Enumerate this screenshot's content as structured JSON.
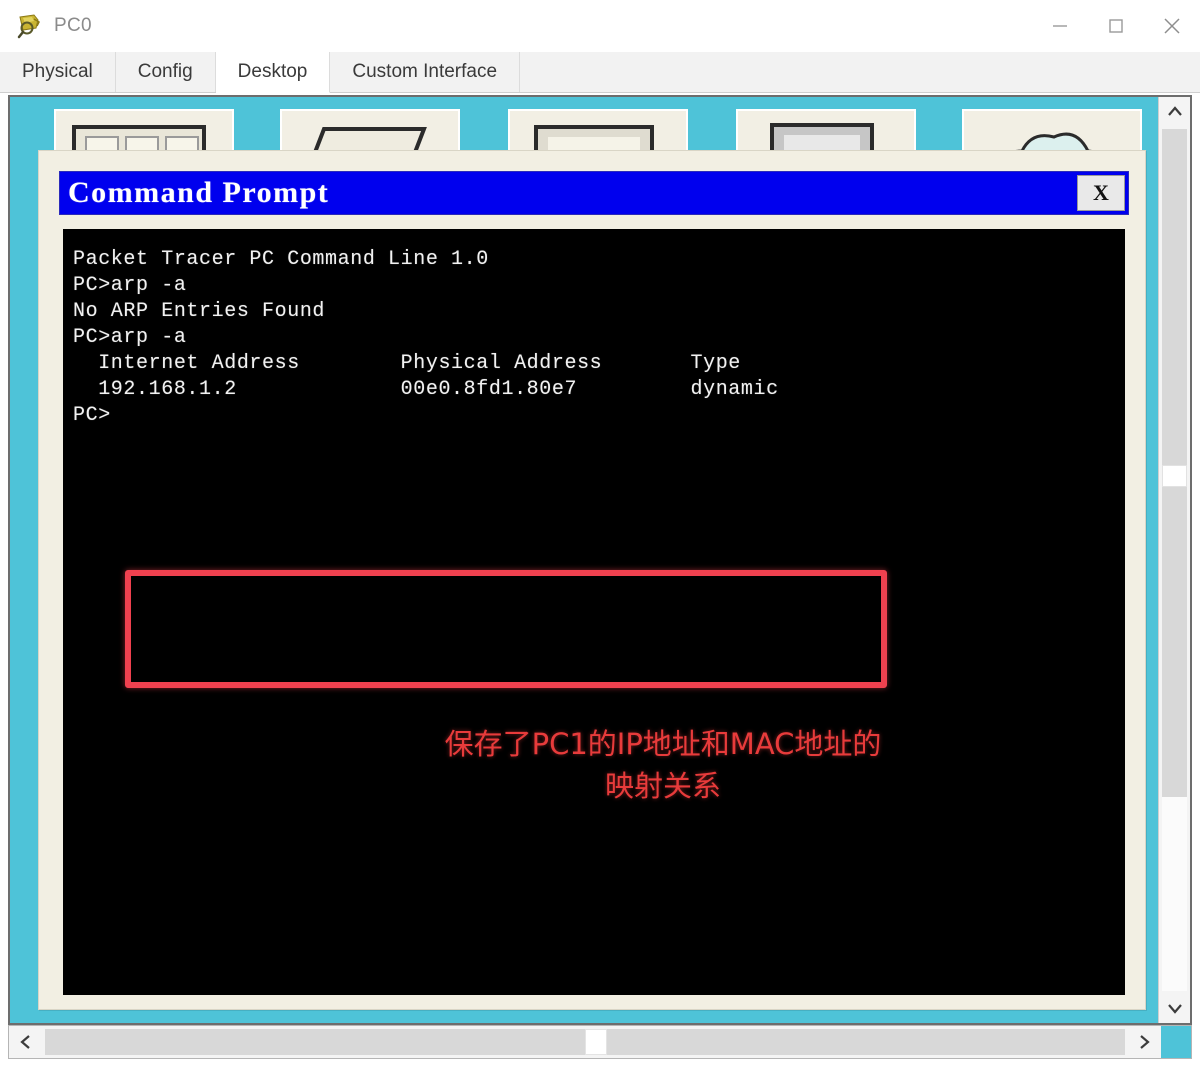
{
  "window": {
    "title": "PC0",
    "icon": "packet-tracer-pc-icon",
    "controls": {
      "minimize": "minimize-icon",
      "maximize": "maximize-icon",
      "close": "close-icon"
    }
  },
  "tabs": [
    {
      "label": "Physical",
      "active": false
    },
    {
      "label": "Config",
      "active": false
    },
    {
      "label": "Desktop",
      "active": true
    },
    {
      "label": "Custom Interface",
      "active": false
    }
  ],
  "command_prompt": {
    "title": "Command Prompt",
    "close_label": "X",
    "terminal_lines": [
      "Packet Tracer PC Command Line 1.0",
      "PC>arp -a",
      "No ARP Entries Found",
      "PC>arp -a",
      "  Internet Address        Physical Address       Type",
      "  192.168.1.2             00e0.8fd1.80e7         dynamic",
      "",
      "PC>"
    ],
    "arp_table": {
      "headers": [
        "Internet Address",
        "Physical Address",
        "Type"
      ],
      "rows": [
        [
          "192.168.1.2",
          "00e0.8fd1.80e7",
          "dynamic"
        ]
      ]
    },
    "commands": [
      "arp -a",
      "arp -a"
    ],
    "banner": "Packet Tracer PC Command Line 1.0",
    "no_entries_message": "No ARP Entries Found",
    "prompt": "PC>"
  },
  "annotation": {
    "line1": "保存了PC1的IP地址和MAC地址的",
    "line2": "映射关系",
    "color": "#e83b3b"
  },
  "highlight": {
    "color": "#f0414f",
    "name": "red-highlight-box"
  },
  "scrollbars": {
    "vertical": {
      "up": "chevron-up-icon",
      "down": "chevron-down-icon"
    },
    "horizontal": {
      "left": "chevron-left-icon",
      "right": "chevron-right-icon"
    }
  },
  "colors": {
    "desktop_background": "#4ec3d8",
    "titlebar_blue": "#0000ee",
    "window_frame": "#f2efe3",
    "terminal_background": "#000000",
    "terminal_text": "#f2f2f2"
  }
}
